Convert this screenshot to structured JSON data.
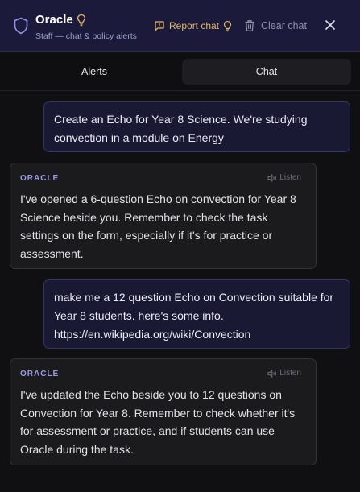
{
  "header": {
    "title": "Oracle",
    "subtitle": "Staff — chat & policy alerts",
    "report_label": "Report chat",
    "clear_label": "Clear chat"
  },
  "tabs": [
    {
      "label": "Alerts",
      "active": false
    },
    {
      "label": "Chat",
      "active": true
    }
  ],
  "messages": [
    {
      "role": "user",
      "text": "Create an Echo for Year 8 Science.  We're studying convection in a module on Energy"
    },
    {
      "role": "assistant",
      "sender": "ORACLE",
      "listen_label": "Listen",
      "text": "I've opened a 6-question Echo on convection for Year 8 Science beside you. Remember to check the task settings on the form, especially if it's for practice or assessment."
    },
    {
      "role": "user",
      "text": "make me a 12 question Echo on Convection suitable for Year 8 students. here's some info. https://en.wikipedia.org/wiki/Convection"
    },
    {
      "role": "assistant",
      "sender": "ORACLE",
      "listen_label": "Listen",
      "text": "I've updated the Echo beside you to 12 questions on Convection for Year 8. Remember to check whether it's for assessment or practice, and if students can use Oracle during the task."
    }
  ],
  "colors": {
    "header_bg": "#1b1a3a",
    "accent": "#9a99e0",
    "report": "#e3b866",
    "user_bubble": "#1a1934",
    "bot_bubble": "#1b1b1e"
  },
  "icons": {
    "brand": "shield-icon",
    "title_badge": "lightbulb-icon",
    "report": "flag-message-icon",
    "clear": "trash-icon",
    "close": "close-icon",
    "listen": "speaker-icon"
  }
}
